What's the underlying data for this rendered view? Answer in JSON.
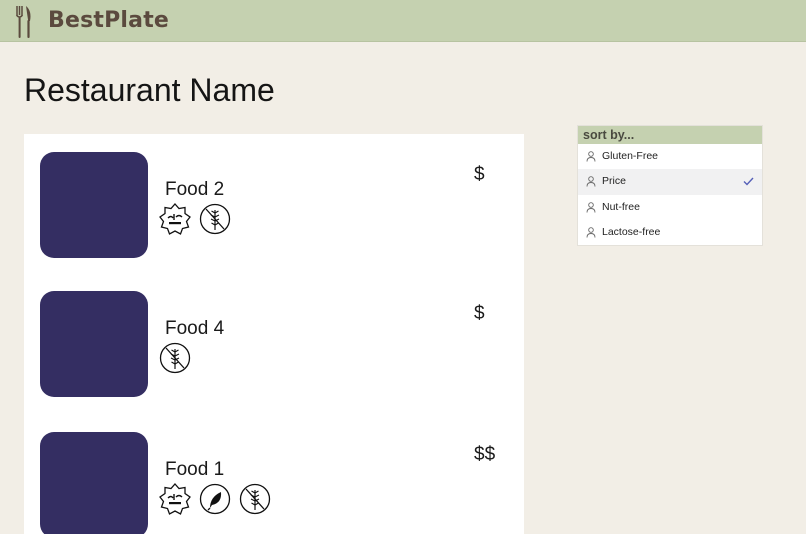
{
  "header": {
    "brand": "BestPlate",
    "logo_icon": "fork-knife-icon"
  },
  "page": {
    "title": "Restaurant Name"
  },
  "menu": {
    "items": [
      {
        "name": "Food 2",
        "price": "$",
        "badges": [
          "halal-icon",
          "gluten-free-icon"
        ]
      },
      {
        "name": "Food 4",
        "price": "$",
        "badges": [
          "gluten-free-icon"
        ]
      },
      {
        "name": "Food 1",
        "price": "$$",
        "badges": [
          "halal-icon",
          "vegan-leaf-icon",
          "gluten-free-icon"
        ]
      }
    ]
  },
  "sort": {
    "header": "sort by...",
    "options": [
      {
        "label": "Gluten-Free",
        "selected": false
      },
      {
        "label": "Price",
        "selected": true
      },
      {
        "label": "Nut-free",
        "selected": false
      },
      {
        "label": "Lactose-free",
        "selected": false
      }
    ]
  },
  "colors": {
    "header_bg": "#c5d1b0",
    "page_bg": "#f2eee6",
    "food_image": "#342e62",
    "brand_text": "#5b4a3e",
    "check": "#5560b8"
  }
}
